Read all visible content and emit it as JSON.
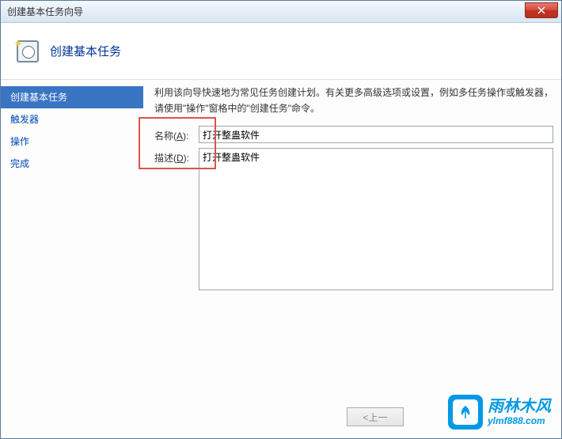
{
  "window": {
    "title": "创建基本任务向导"
  },
  "header": {
    "title": "创建基本任务"
  },
  "sidebar": {
    "items": [
      {
        "label": "创建基本任务",
        "active": true
      },
      {
        "label": "触发器",
        "active": false
      },
      {
        "label": "操作",
        "active": false
      },
      {
        "label": "完成",
        "active": false
      }
    ]
  },
  "main": {
    "description": "利用该向导快速地为常见任务创建计划。有关更多高级选项或设置，例如多任务操作或触发器，请使用\"操作\"窗格中的\"创建任务\"命令。",
    "nameLabelPrefix": "名称(",
    "nameAccel": "A",
    "nameLabelSuffix": "):",
    "nameValue": "打开整蛊软件",
    "descLabelPrefix": "描述(",
    "descAccel": "D",
    "descLabelSuffix": "):",
    "descValue": "打开整蛊软件"
  },
  "footer": {
    "backLabel": "<上一"
  },
  "watermark": {
    "text": "雨林木风",
    "url": "ylmf888.com"
  }
}
